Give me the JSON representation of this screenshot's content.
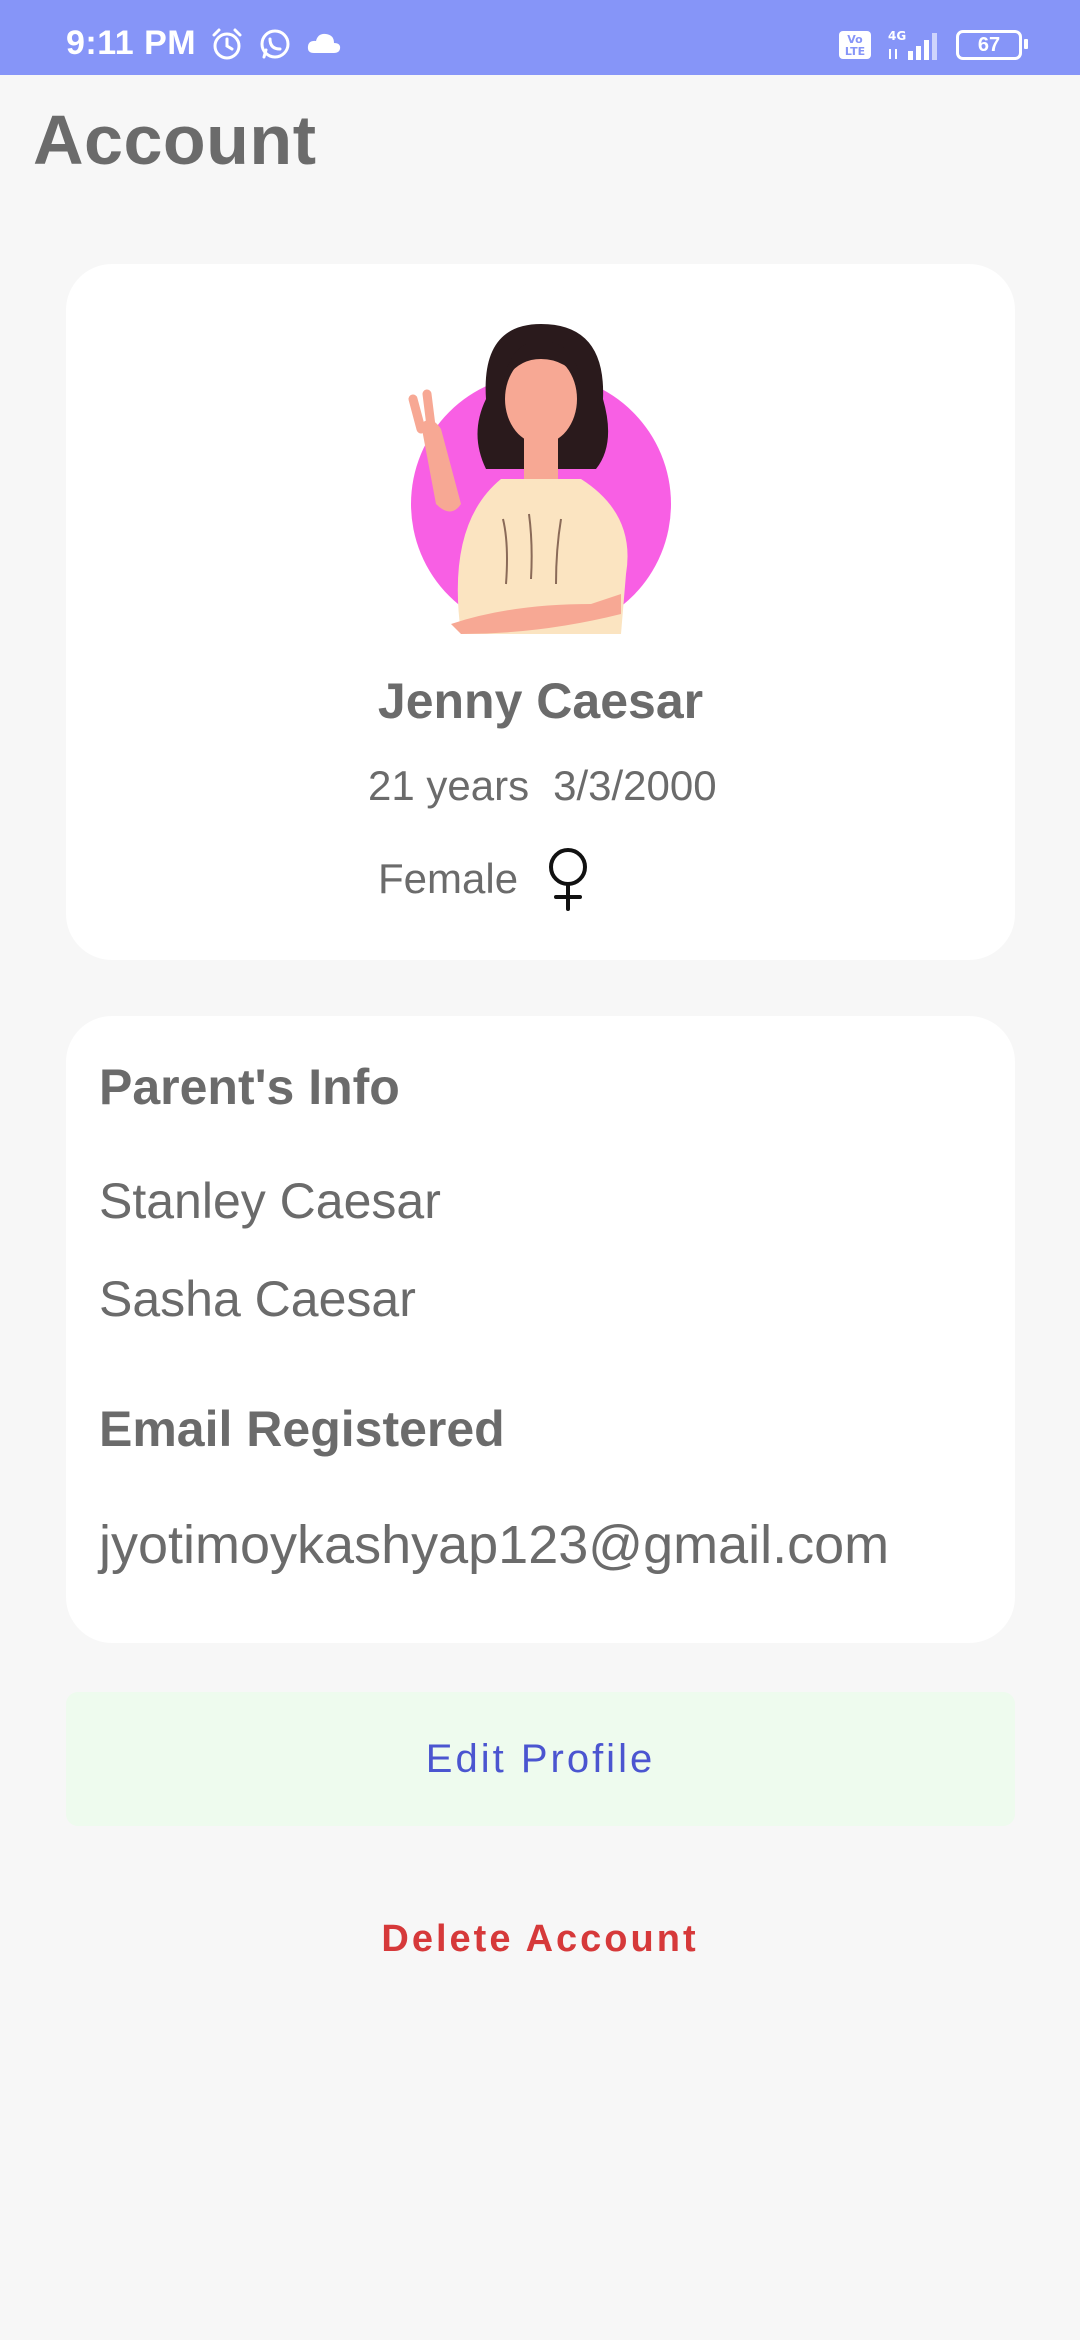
{
  "status_bar": {
    "time": "9:11 PM",
    "icons_left": [
      "alarm-icon",
      "whatsapp-icon",
      "cloud-icon"
    ],
    "icons_right": [
      "volte-icon",
      "signal-4g-icon",
      "battery-icon"
    ],
    "volte_label": "Vo LTE",
    "network_label": "4G",
    "battery_level": "67",
    "bar_color": "#8695f8"
  },
  "page": {
    "title": "Account"
  },
  "profile": {
    "avatar_icon": "girl-avatar-icon",
    "name": "Jenny Caesar",
    "age": "21 years",
    "dob": "3/3/2000",
    "gender": "Female",
    "gender_icon": "female-symbol-icon"
  },
  "parents_info": {
    "heading": "Parent's Info",
    "names": [
      "Stanley Caesar",
      "Sasha Caesar"
    ]
  },
  "email_section": {
    "heading": "Email Registered",
    "email": "jyotimoykashyap123@gmail.com"
  },
  "actions": {
    "edit_label": "Edit Profile",
    "delete_label": "Delete Account",
    "edit_text_color": "#4b55d0",
    "edit_bg_color": "#eefbee",
    "delete_color": "#d6393a"
  }
}
